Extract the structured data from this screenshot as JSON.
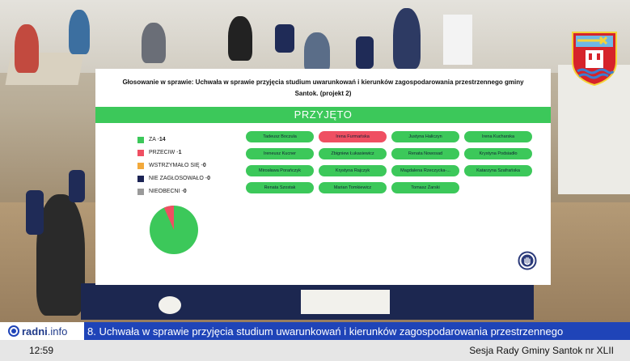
{
  "panel": {
    "title": "Głosowanie w sprawie: Uchwała w sprawie przyjęcia studium uwarunkowań i kierunków zagospodarowania przestrzennego gminy Santok. (projekt 2)",
    "result": "PRZYJĘTO",
    "legend": [
      {
        "label": "ZA",
        "count": "14",
        "color": "#3cc85a"
      },
      {
        "label": "PRZECIW",
        "count": "1",
        "color": "#ef4f62"
      },
      {
        "label": "WSTRZYMAŁO SIĘ",
        "count": "0",
        "color": "#f2a93b"
      },
      {
        "label": "NIE ZAGŁOSOWAŁO",
        "count": "0",
        "color": "#1c2455"
      },
      {
        "label": "NIEOBECNI",
        "count": "0",
        "color": "#9a9a9a"
      }
    ],
    "legend_sep": " - ",
    "voters": [
      {
        "name": "Tadeusz Boczula",
        "vote": "za"
      },
      {
        "name": "Irena Furmańska",
        "vote": "przeciw"
      },
      {
        "name": "Justyna Haliczyn",
        "vote": "za"
      },
      {
        "name": "Irena Kucharska",
        "vote": "za"
      },
      {
        "name": "Ireneusz Kucner",
        "vote": "za"
      },
      {
        "name": "Zbigniew Łukasiewicz",
        "vote": "za"
      },
      {
        "name": "Renata Nowosad",
        "vote": "za"
      },
      {
        "name": "Krystyna Podsiadło",
        "vote": "za"
      },
      {
        "name": "Mirosława Porańczyk",
        "vote": "za"
      },
      {
        "name": "Krystyna Rajczyk",
        "vote": "za"
      },
      {
        "name": "Magdalena Rzeczycka-...",
        "vote": "za"
      },
      {
        "name": "Katarzyna Szafrańska",
        "vote": "za"
      },
      {
        "name": "Renata Szostak",
        "vote": "za"
      },
      {
        "name": "Marian Tomkiewicz",
        "vote": "za"
      },
      {
        "name": "Tomasz Żarski",
        "vote": "za"
      }
    ],
    "pie": {
      "za": 14,
      "przeciw": 1
    }
  },
  "ticker": {
    "brand": "radni",
    "brand_suffix": ".info",
    "headline": "8. Uchwała w sprawie przyjęcia studium uwarunkowań i kierunków zagospodarowania przestrzennego"
  },
  "status": {
    "time": "12:59",
    "session": "Sesja Rady Gminy Santok nr XLII"
  },
  "colors": {
    "accent_green": "#3cc85a",
    "against_red": "#ef4f62",
    "ticker_blue": "#1f44b8"
  },
  "icons": {
    "coat_of_arms": "coat-of-arms-icon",
    "hand": "raised-hand-icon",
    "brand": "radni-logo-icon"
  }
}
